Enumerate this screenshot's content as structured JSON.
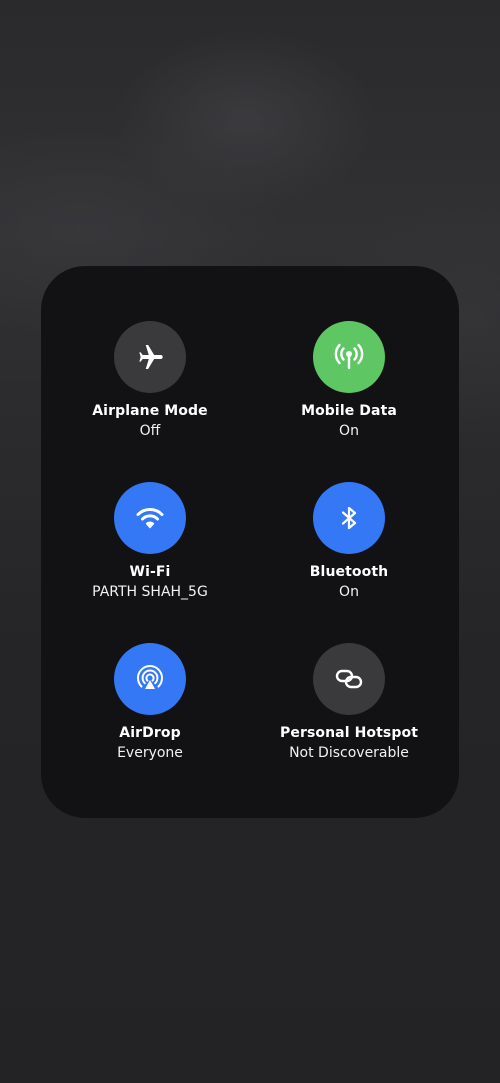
{
  "connectivity": {
    "tiles": [
      {
        "name": "Airplane Mode",
        "status": "Off",
        "icon": "airplane-icon",
        "state": "off"
      },
      {
        "name": "Mobile Data",
        "status": "On",
        "icon": "antenna-icon",
        "state": "on",
        "color": "#5fc664"
      },
      {
        "name": "Wi-Fi",
        "status": "PARTH SHAH_5G",
        "icon": "wifi-icon",
        "state": "on",
        "color": "#3478f6"
      },
      {
        "name": "Bluetooth",
        "status": "On",
        "icon": "bluetooth-icon",
        "state": "on",
        "color": "#3478f6"
      },
      {
        "name": "AirDrop",
        "status": "Everyone",
        "icon": "airdrop-icon",
        "state": "on",
        "color": "#3478f6"
      },
      {
        "name": "Personal Hotspot",
        "status": "Not Discoverable",
        "icon": "link-icon",
        "state": "off"
      }
    ]
  },
  "colors": {
    "inactive": "#3a3a3c",
    "green": "#5fc664",
    "blue": "#3478f6",
    "panel": "#121214"
  }
}
